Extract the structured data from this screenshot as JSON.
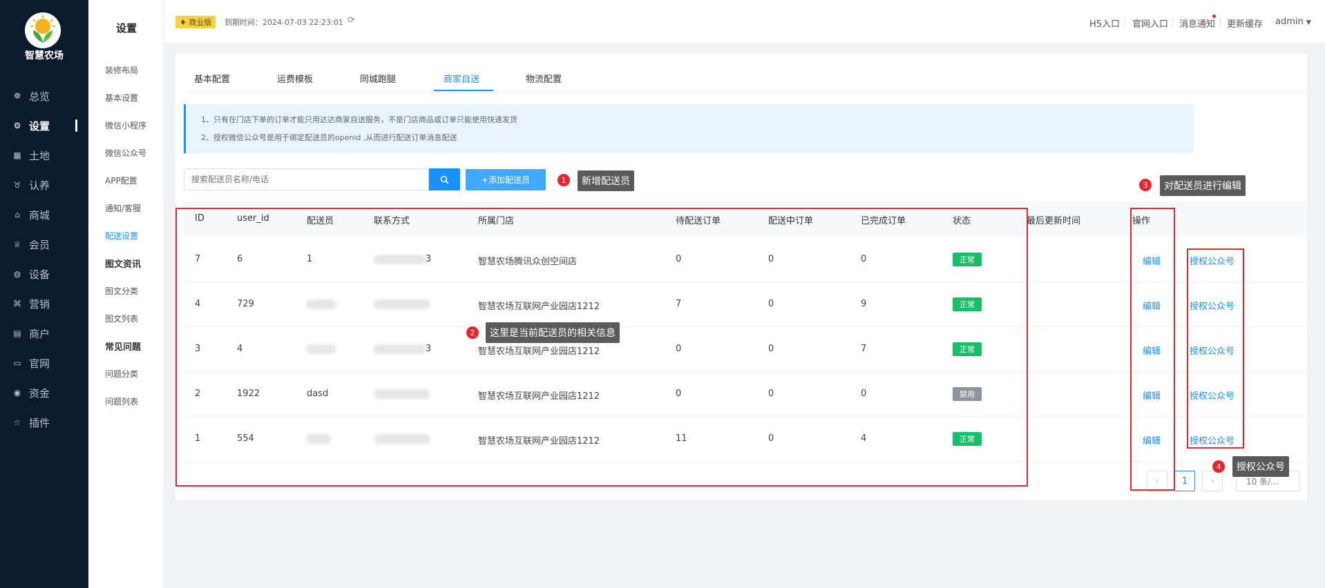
{
  "brand": {
    "name": "智慧农场"
  },
  "nav": {
    "items": [
      {
        "label": "总览",
        "icon": "dashboard-icon",
        "glyph": "❁"
      },
      {
        "label": "设置",
        "icon": "gear-icon",
        "glyph": "⚙"
      },
      {
        "label": "土地",
        "icon": "grid-icon",
        "glyph": "▦"
      },
      {
        "label": "认养",
        "icon": "adopt-icon",
        "glyph": "♉"
      },
      {
        "label": "商城",
        "icon": "shop-icon",
        "glyph": "⌂"
      },
      {
        "label": "会员",
        "icon": "member-icon",
        "glyph": "♕"
      },
      {
        "label": "设备",
        "icon": "device-icon",
        "glyph": "◍"
      },
      {
        "label": "营销",
        "icon": "marketing-icon",
        "glyph": "⌘"
      },
      {
        "label": "商户",
        "icon": "merchant-icon",
        "glyph": "▤"
      },
      {
        "label": "官网",
        "icon": "website-icon",
        "glyph": "▭"
      },
      {
        "label": "资金",
        "icon": "funds-icon",
        "glyph": "◉"
      },
      {
        "label": "插件",
        "icon": "plugin-icon",
        "glyph": "☆"
      }
    ]
  },
  "submenu": {
    "title": "设置",
    "items": [
      "装修布局",
      "基本设置",
      "微信小程序",
      "微信公众号",
      "APP配置",
      "通知/客服",
      "配送设置"
    ],
    "groups": [
      {
        "title": "图文资讯",
        "items": [
          "图文分类",
          "图文列表"
        ]
      },
      {
        "title": "常见问题",
        "items": [
          "问题分类",
          "问题列表"
        ]
      }
    ]
  },
  "header": {
    "edition": "商业版",
    "expire_label": "到期时间：2024-07-03 22:23:01",
    "links": [
      "H5入口",
      "官网入口",
      "消息通知",
      "更新缓存"
    ],
    "user": "admin"
  },
  "tabs": [
    "基本配置",
    "运费模板",
    "同城跑腿",
    "商家自送",
    "物流配置"
  ],
  "notice": [
    "1、只有在门店下单的订单才能只用达达商家自送服务，不是门店商品或订单只能使用快递发货",
    "2、授权微信公众号是用于绑定配送员的openid ,从而进行配送订单消息配送"
  ],
  "search": {
    "placeholder": "搜索配送员名称/电话"
  },
  "add_button": "+添加配送员",
  "table": {
    "headers": [
      "ID",
      "user_id",
      "配送员",
      "联系方式",
      "所属门店",
      "待配送订单",
      "配送中订单",
      "已完成订单",
      "状态",
      "最后更新时间",
      "操作"
    ],
    "rows": [
      {
        "id": "7",
        "user_id": "6",
        "name": "1",
        "phone": "3",
        "store": "智慧农场腾讯众创空间店",
        "pending": "0",
        "delivering": "0",
        "done": "0",
        "status": "正常",
        "active": true
      },
      {
        "id": "4",
        "user_id": "729",
        "name": "",
        "phone": "",
        "store": "智慧农场互联网产业园店1212",
        "pending": "7",
        "delivering": "0",
        "done": "9",
        "status": "正常",
        "active": true
      },
      {
        "id": "3",
        "user_id": "4",
        "name": "",
        "phone": "3",
        "store": "智慧农场互联网产业园店1212",
        "pending": "0",
        "delivering": "0",
        "done": "7",
        "status": "正常",
        "active": true
      },
      {
        "id": "2",
        "user_id": "1922",
        "name": "dasd",
        "phone": "",
        "store": "智慧农场互联网产业园店1212",
        "pending": "0",
        "delivering": "0",
        "done": "0",
        "status": "禁用",
        "active": false
      },
      {
        "id": "1",
        "user_id": "554",
        "name": "",
        "phone": "",
        "store": "智慧农场互联网产业园店1212",
        "pending": "11",
        "delivering": "0",
        "done": "4",
        "status": "正常",
        "active": true
      }
    ],
    "edit_label": "编辑",
    "auth_label": "授权公众号"
  },
  "pagination": {
    "current": "1",
    "page_size": "10 条/..."
  },
  "annotations": [
    {
      "num": "1",
      "text": "新增配送员"
    },
    {
      "num": "2",
      "text": "这里是当前配送员的相关信息"
    },
    {
      "num": "3",
      "text": "对配送员进行编辑"
    },
    {
      "num": "4",
      "text": "授权公众号"
    }
  ],
  "colors": {
    "accent": "#1890ff",
    "sidebar": "#0c1a2e",
    "annotation": "#e5262c",
    "success": "#19be6b",
    "disabled": "#909399"
  }
}
